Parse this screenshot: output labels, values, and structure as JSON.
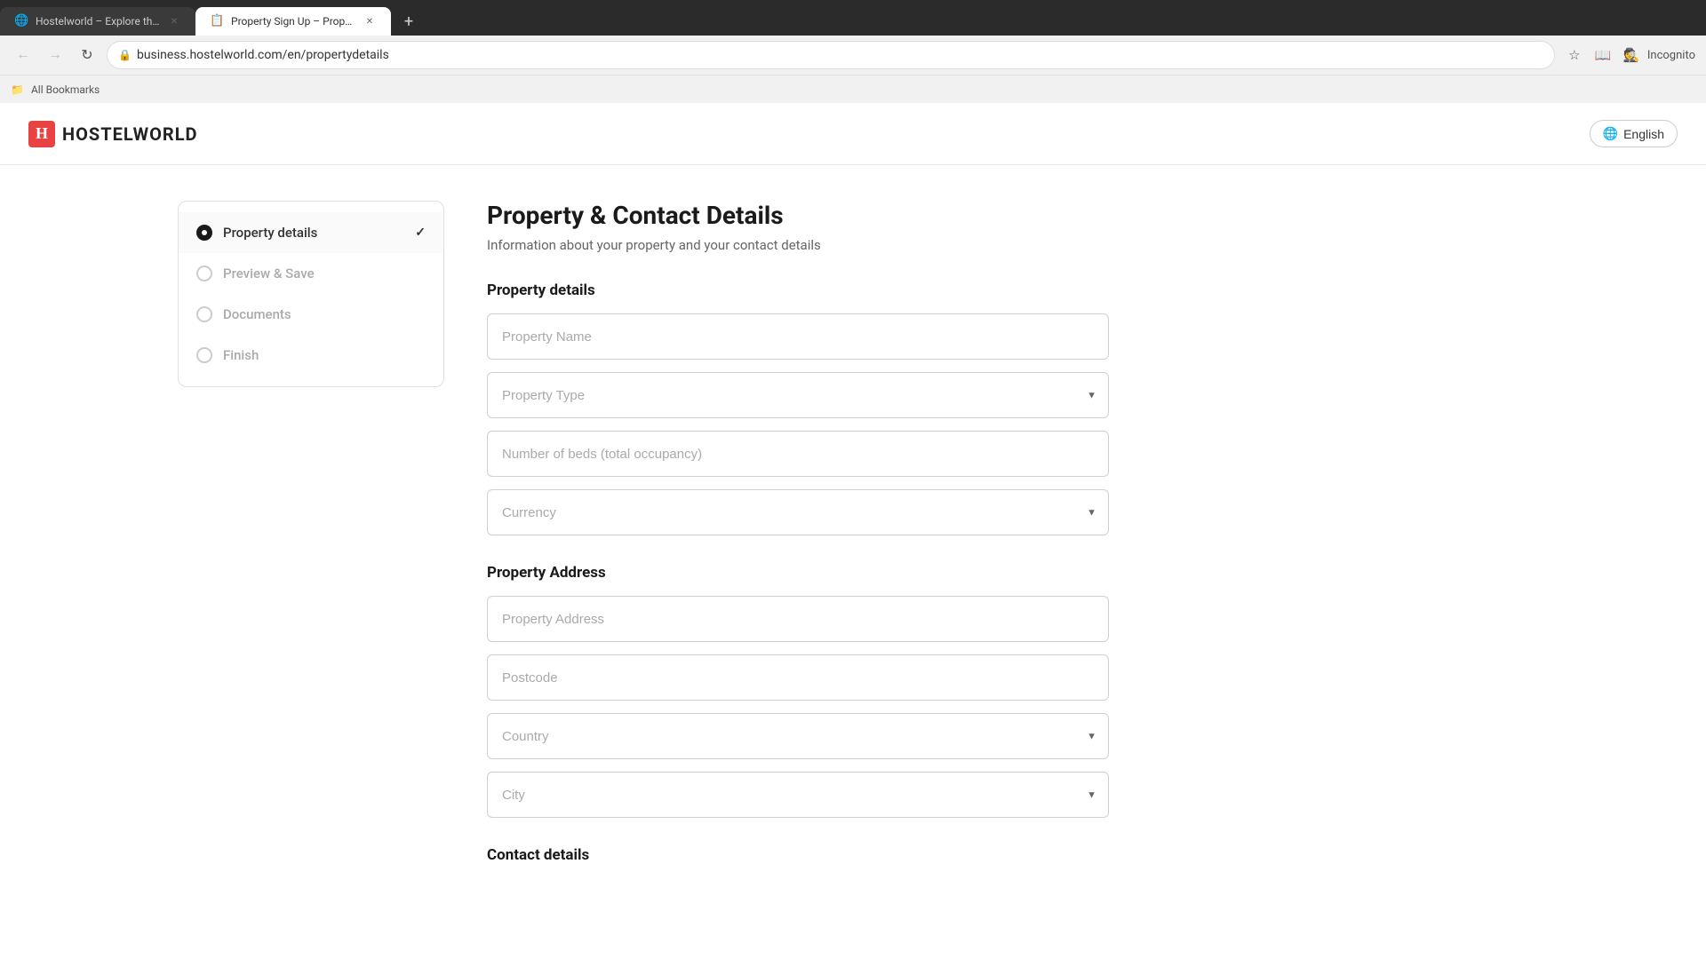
{
  "browser": {
    "tabs": [
      {
        "id": "tab1",
        "favicon": "🌐",
        "title": "Hostelworld – Explore the worl...",
        "active": false,
        "url": ""
      },
      {
        "id": "tab2",
        "favicon": "📋",
        "title": "Property Sign Up – Property an...",
        "active": true,
        "url": "business.hostelworld.com/en/propertydetails"
      }
    ],
    "address": "business.hostelworld.com/en/propertydetails",
    "bookmarks_label": "All Bookmarks"
  },
  "header": {
    "logo_letter": "H",
    "logo_text": "HOSTELWORLD",
    "lang_button": "English"
  },
  "sidebar": {
    "items": [
      {
        "id": "property-details",
        "label": "Property details",
        "state": "active",
        "has_check": true
      },
      {
        "id": "preview-save",
        "label": "Preview & Save",
        "state": "inactive",
        "has_check": false
      },
      {
        "id": "documents",
        "label": "Documents",
        "state": "inactive",
        "has_check": false
      },
      {
        "id": "finish",
        "label": "Finish",
        "state": "inactive",
        "has_check": false
      }
    ]
  },
  "page": {
    "title": "Property & Contact Details",
    "subtitle": "Information about your property and your contact details",
    "property_details_section": "Property details",
    "property_address_section": "Property Address",
    "contact_details_section": "Contact details",
    "fields": {
      "property_name_placeholder": "Property Name",
      "property_type_placeholder": "Property Type",
      "num_beds_placeholder": "Number of beds (total occupancy)",
      "currency_placeholder": "Currency",
      "property_address_placeholder": "Property Address",
      "postcode_placeholder": "Postcode",
      "country_placeholder": "Country",
      "city_placeholder": "City"
    }
  }
}
